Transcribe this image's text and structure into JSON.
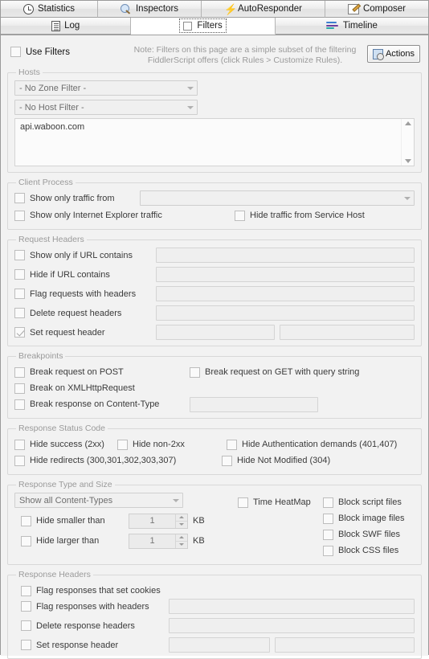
{
  "tabs_row1": [
    {
      "label": "Statistics",
      "icon": "clock-icon"
    },
    {
      "label": "Inspectors",
      "icon": "magnifier-icon"
    },
    {
      "label": "AutoResponder",
      "icon": "lightning-bolt-icon"
    },
    {
      "label": "Composer",
      "icon": "pencil-icon"
    }
  ],
  "tabs_row2": [
    {
      "label": "Log",
      "icon": "document-icon"
    },
    {
      "label": "Filters",
      "icon": "checkbox-icon"
    },
    {
      "label": "Timeline",
      "icon": "timeline-bars-icon"
    }
  ],
  "header": {
    "use_filters_label": "Use Filters",
    "note_line1": "Note: Filters on this page are a simple subset of the filtering",
    "note_line2": "FiddlerScript offers (click Rules > Customize Rules).",
    "actions_label": "Actions"
  },
  "hosts": {
    "legend": "Hosts",
    "zone_filter": "- No Zone Filter -",
    "host_filter": "- No Host Filter -",
    "host_list": "api.waboon.com"
  },
  "client_process": {
    "legend": "Client Process",
    "show_only_traffic_from": "Show only traffic from",
    "process_value": "",
    "show_only_ie": "Show only Internet Explorer traffic",
    "hide_service_host": "Hide traffic from Service Host"
  },
  "request_headers": {
    "legend": "Request Headers",
    "rows": [
      {
        "label": "Show only if URL contains",
        "value": ""
      },
      {
        "label": "Hide if URL contains",
        "value": ""
      },
      {
        "label": "Flag requests with headers",
        "value": ""
      },
      {
        "label": "Delete request headers",
        "value": ""
      }
    ],
    "set_request_header": "Set request header",
    "set_header_name": "",
    "set_header_value": ""
  },
  "breakpoints": {
    "legend": "Breakpoints",
    "break_on_post": "Break request on POST",
    "break_on_get": "Break request on GET with query string",
    "break_on_xhr": "Break on XMLHttpRequest",
    "break_on_content_type": "Break response on Content-Type",
    "content_type_value": ""
  },
  "response_status": {
    "legend": "Response Status Code",
    "hide_success": "Hide success (2xx)",
    "hide_non_2xx": "Hide non-2xx",
    "hide_auth": "Hide Authentication demands (401,407)",
    "hide_redirects": "Hide redirects (300,301,302,303,307)",
    "hide_not_modified": "Hide Not Modified (304)"
  },
  "response_type": {
    "legend": "Response Type and Size",
    "content_types": "Show all Content-Types",
    "hide_smaller_than": "Hide smaller than",
    "hide_smaller_value": "1",
    "hide_smaller_unit": "KB",
    "hide_larger_than": "Hide larger than",
    "hide_larger_value": "1",
    "hide_larger_unit": "KB",
    "time_heatmap": "Time HeatMap",
    "block_script": "Block script files",
    "block_image": "Block image files",
    "block_swf": "Block SWF files",
    "block_css": "Block CSS files"
  },
  "response_headers": {
    "legend": "Response Headers",
    "flag_cookies": "Flag responses that set cookies",
    "flag_with_headers": "Flag responses with headers",
    "flag_with_headers_value": "",
    "delete_response_headers": "Delete response headers",
    "delete_value": "",
    "set_response_header": "Set response header",
    "set_header_name": "",
    "set_header_value": ""
  }
}
